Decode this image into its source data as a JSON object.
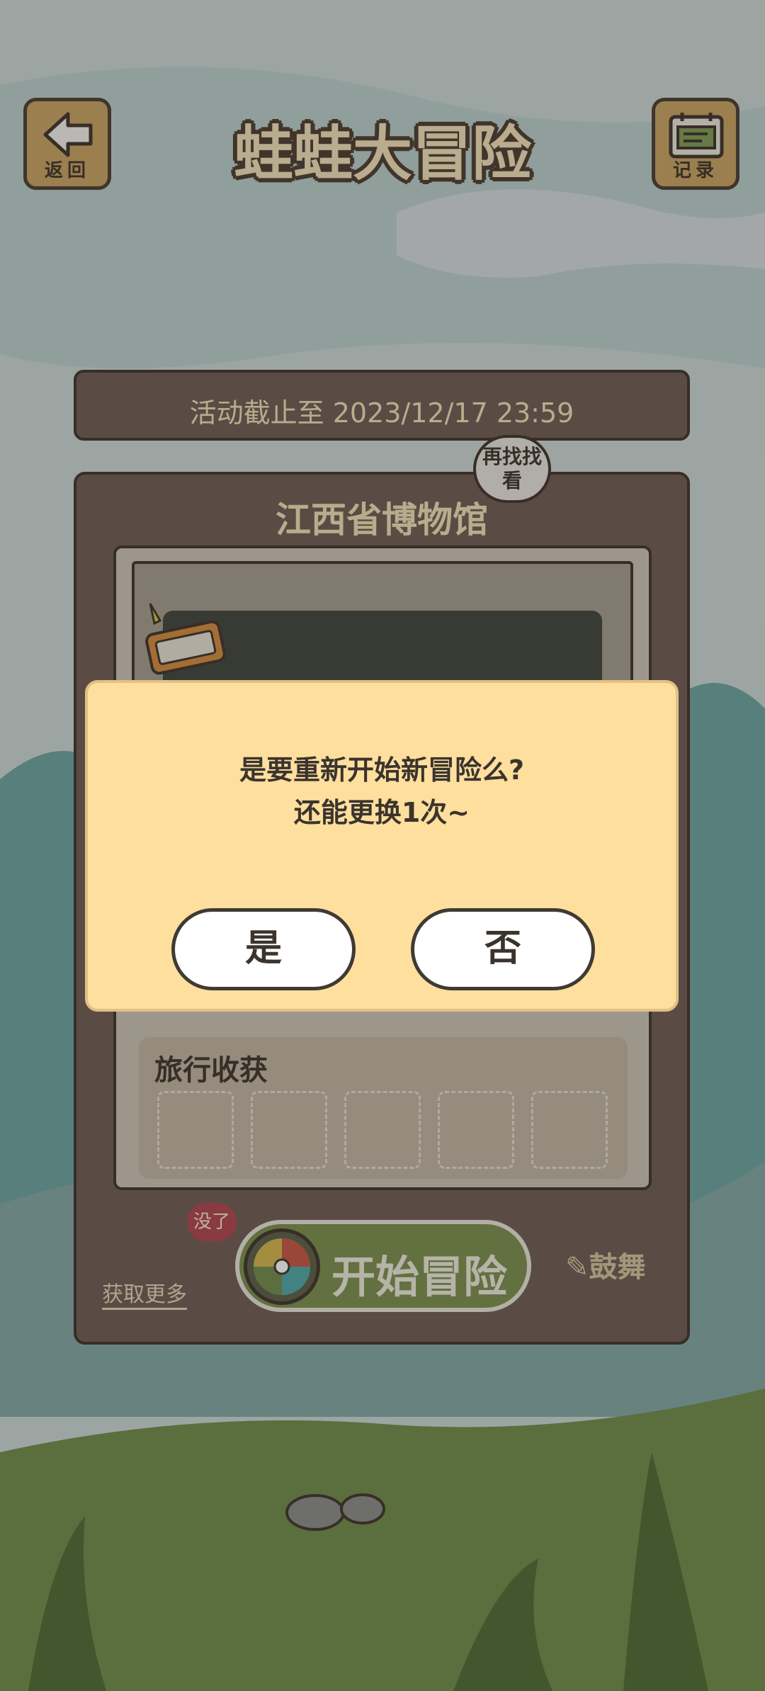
{
  "header": {
    "back_label": "返回",
    "title": "蛙蛙大冒险",
    "record_label": "记录"
  },
  "event": {
    "deadline": "活动截止至 2023/12/17 23:59",
    "search_again": "再找找看",
    "location": "江西省博物馆"
  },
  "harvest": {
    "title": "旅行收获",
    "slots": 5
  },
  "actions": {
    "get_more": "获取更多",
    "none_badge": "没了",
    "start_label": "开始冒险",
    "cheer_label": "鼓舞"
  },
  "dialog": {
    "line1": "是要重新开始新冒险么?",
    "line2": "还能更换1次~",
    "yes": "是",
    "no": "否"
  },
  "colors": {
    "board": "#6e5b50",
    "dialog_bg": "#ffdf9e",
    "start_button": "#7b8c49",
    "outline": "#3d3128"
  }
}
